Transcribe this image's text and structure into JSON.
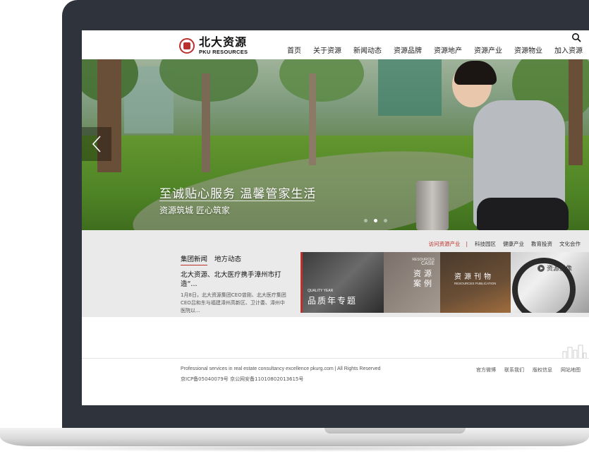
{
  "header": {
    "logo_cn": "北大资源",
    "logo_en": "PKU RESOURCES",
    "nav": [
      {
        "label": "首页"
      },
      {
        "label": "关于资源"
      },
      {
        "label": "新闻动态"
      },
      {
        "label": "资源品牌"
      },
      {
        "label": "资源地产"
      },
      {
        "label": "资源产业"
      },
      {
        "label": "资源物业"
      },
      {
        "label": "加入资源"
      }
    ],
    "search_icon": "search-icon"
  },
  "hero": {
    "title": "至诚贴心服务  温馨管家生活",
    "subtitle": "资源筑城 匠心筑家",
    "prev_icon": "chevron-left-icon",
    "slides": 3,
    "active_slide": 2
  },
  "categories": {
    "accent": "访问资源产业",
    "separator": "|",
    "links": [
      "科技园区",
      "健康产业",
      "教育投资",
      "文化会作"
    ]
  },
  "news": {
    "tabs": [
      "集团新闻",
      "地方动态"
    ],
    "headline": "北大资源、北大医疗携手漳州市打造“...",
    "body": "1月8日，北大资源集团CEO曾刚、北大医疗集团CEO吕和东与福建漳州高新区、卫计委、漳州中医院以..."
  },
  "tiles": {
    "quality_en": "QUALITY YEAR",
    "quality_cn": "品质年专题",
    "case_en_1": "RESOURCES",
    "case_en_2": "CASE",
    "case_cn": "资源案例",
    "pub_cn": "资源刊物",
    "pub_en": "RESOURCES PUBLICATION",
    "video_label": "资源影像"
  },
  "footer": {
    "copyright": "Professional services in real estate consultancy excellence pkurg.com | All Rights Reserved",
    "icp": "京ICP备05040079号 京公网安备11010802013615号",
    "links": [
      "官方微博",
      "联系我们",
      "版权信息",
      "网站地图"
    ]
  },
  "colors": {
    "accent": "#c0302b",
    "bezel": "#2f343c"
  }
}
